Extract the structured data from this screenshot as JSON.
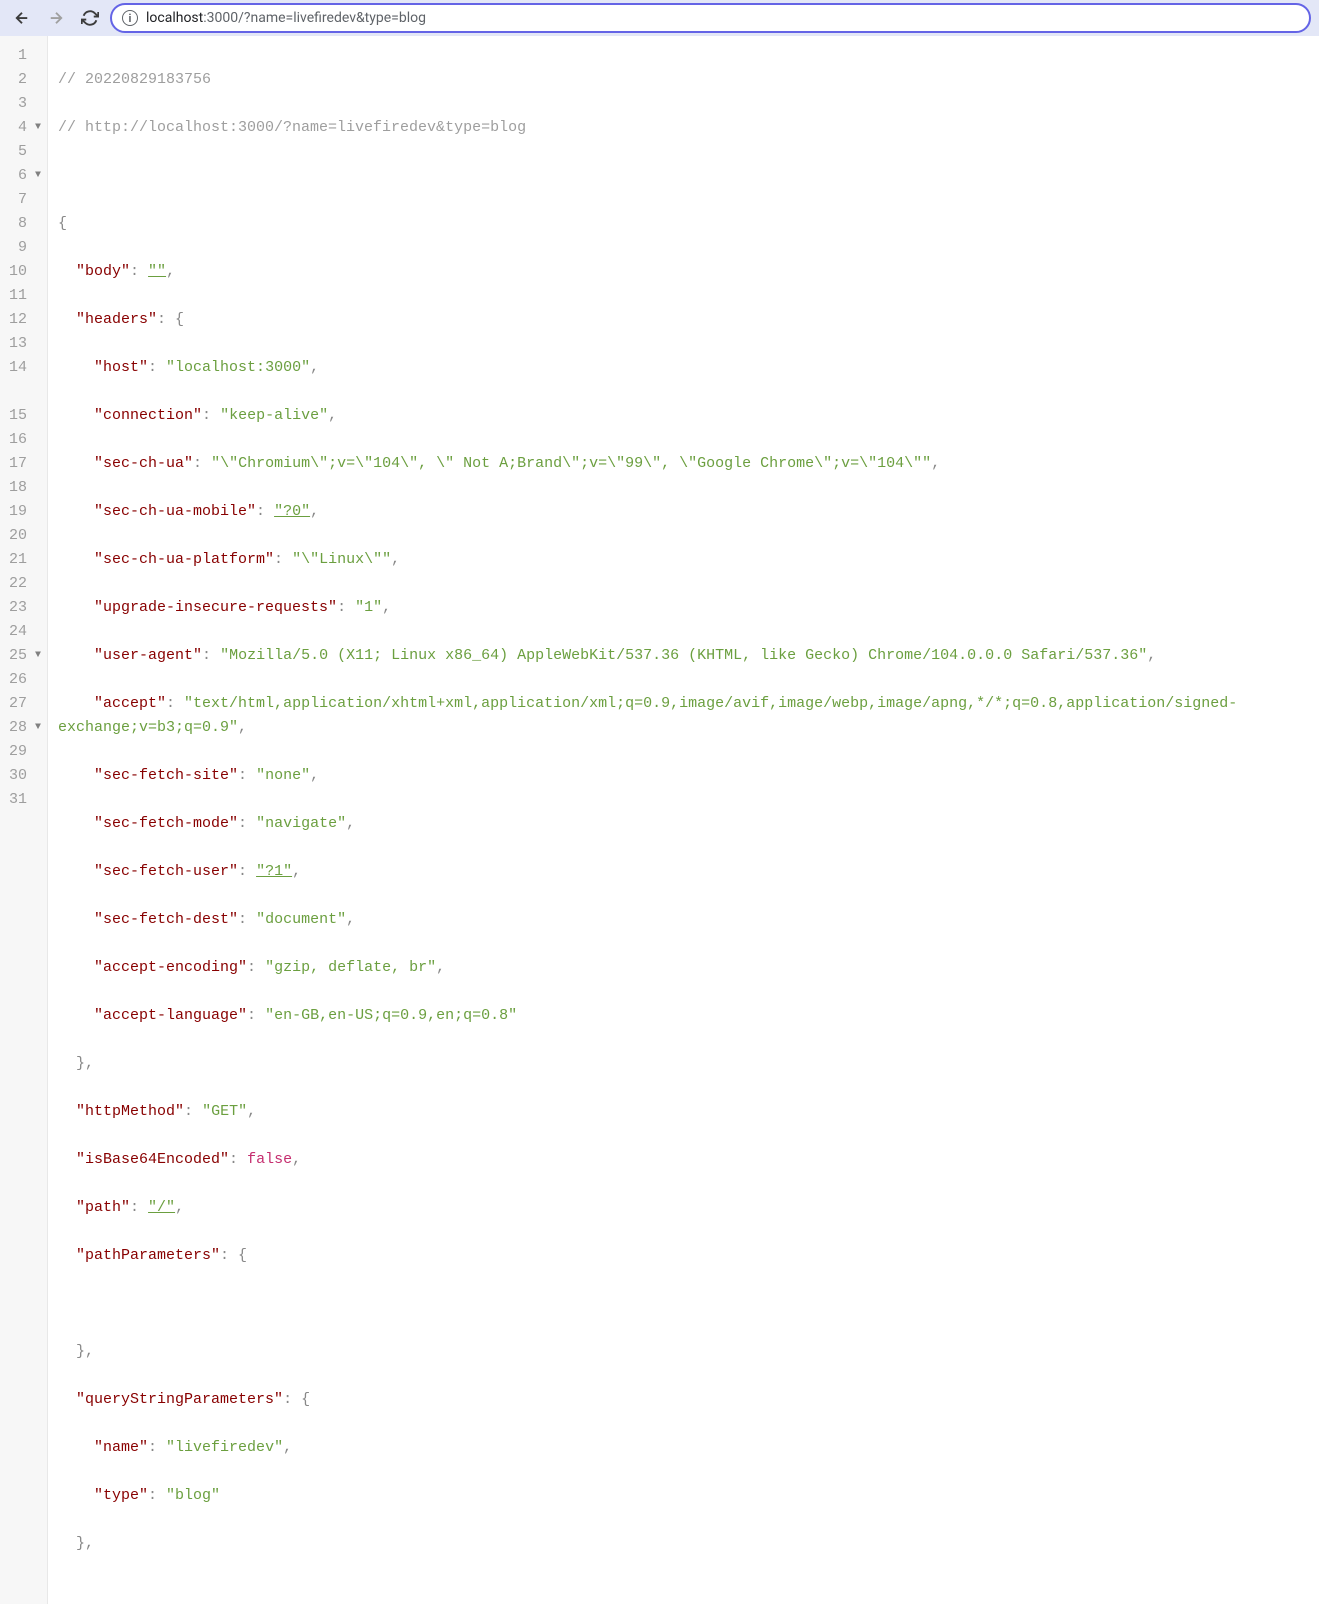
{
  "toolbar": {
    "url_host": "localhost",
    "url_rest": ":3000/?name=livefiredev&type=blog"
  },
  "gutter": {
    "lines": [
      {
        "n": "1",
        "fold": ""
      },
      {
        "n": "2",
        "fold": ""
      },
      {
        "n": "3",
        "fold": ""
      },
      {
        "n": "4",
        "fold": "▼"
      },
      {
        "n": "5",
        "fold": ""
      },
      {
        "n": "6",
        "fold": "▼"
      },
      {
        "n": "7",
        "fold": ""
      },
      {
        "n": "8",
        "fold": ""
      },
      {
        "n": "9",
        "fold": ""
      },
      {
        "n": "10",
        "fold": ""
      },
      {
        "n": "11",
        "fold": ""
      },
      {
        "n": "12",
        "fold": ""
      },
      {
        "n": "13",
        "fold": ""
      },
      {
        "n": "14",
        "fold": ""
      },
      {
        "n": "15",
        "fold": ""
      },
      {
        "n": "16",
        "fold": ""
      },
      {
        "n": "17",
        "fold": ""
      },
      {
        "n": "18",
        "fold": ""
      },
      {
        "n": "19",
        "fold": ""
      },
      {
        "n": "20",
        "fold": ""
      },
      {
        "n": "21",
        "fold": ""
      },
      {
        "n": "22",
        "fold": ""
      },
      {
        "n": "23",
        "fold": ""
      },
      {
        "n": "24",
        "fold": ""
      },
      {
        "n": "25",
        "fold": "▼"
      },
      {
        "n": "26",
        "fold": ""
      },
      {
        "n": "27",
        "fold": ""
      },
      {
        "n": "28",
        "fold": "▼"
      },
      {
        "n": "29",
        "fold": ""
      },
      {
        "n": "30",
        "fold": ""
      },
      {
        "n": "31",
        "fold": ""
      }
    ]
  },
  "code": {
    "c1": "// 20220829183756",
    "c2": "// http://localhost:3000/?name=livefiredev&type=blog",
    "brace_open": "{",
    "body_key": "\"body\"",
    "body_val": "\"\"",
    "headers_key": "\"headers\"",
    "host_key": "\"host\"",
    "host_val": "\"localhost:3000\"",
    "conn_key": "\"connection\"",
    "conn_val": "\"keep-alive\"",
    "secchua_key": "\"sec-ch-ua\"",
    "secchua_val": "\"\\\"Chromium\\\";v=\\\"104\\\", \\\" Not A;Brand\\\";v=\\\"99\\\", \\\"Google Chrome\\\";v=\\\"104\\\"\"",
    "secchuamob_key": "\"sec-ch-ua-mobile\"",
    "secchuamob_val": "\"?0\"",
    "secchuaplat_key": "\"sec-ch-ua-platform\"",
    "secchuaplat_val": "\"\\\"Linux\\\"\"",
    "upgrade_key": "\"upgrade-insecure-requests\"",
    "upgrade_val": "\"1\"",
    "ua_key": "\"user-agent\"",
    "ua_val": "\"Mozilla/5.0 (X11; Linux x86_64) AppleWebKit/537.36 (KHTML, like Gecko) Chrome/104.0.0.0 Safari/537.36\"",
    "accept_key": "\"accept\"",
    "accept_val": "\"text/html,application/xhtml+xml,application/xml;q=0.9,image/avif,image/webp,image/apng,*/*;q=0.8,application/signed-exchange;v=b3;q=0.9\"",
    "sfsite_key": "\"sec-fetch-site\"",
    "sfsite_val": "\"none\"",
    "sfmode_key": "\"sec-fetch-mode\"",
    "sfmode_val": "\"navigate\"",
    "sfuser_key": "\"sec-fetch-user\"",
    "sfuser_val": "\"?1\"",
    "sfdest_key": "\"sec-fetch-dest\"",
    "sfdest_val": "\"document\"",
    "ae_key": "\"accept-encoding\"",
    "ae_val": "\"gzip, deflate, br\"",
    "al_key": "\"accept-language\"",
    "al_val": "\"en-GB,en-US;q=0.9,en;q=0.8\"",
    "httpm_key": "\"httpMethod\"",
    "httpm_val": "\"GET\"",
    "b64_key": "\"isBase64Encoded\"",
    "b64_val": "false",
    "path_key": "\"path\"",
    "path_val": "\"/\"",
    "pathp_key": "\"pathParameters\"",
    "qsp_key": "\"queryStringParameters\"",
    "name_key": "\"name\"",
    "name_val": "\"livefiredev\"",
    "type_key": "\"type\"",
    "type_val": "\"blog\"",
    "brace_close": "},",
    "obj_open": "{",
    "colon": ": ",
    "comma": ","
  }
}
